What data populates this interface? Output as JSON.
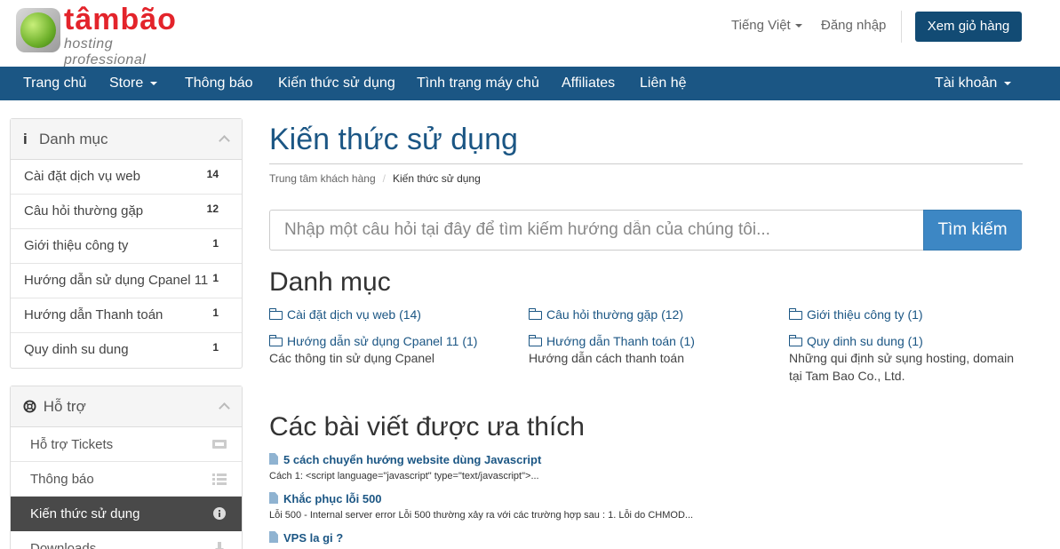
{
  "header": {
    "brand": "tâmbão",
    "tagline": "hosting professional",
    "language": "Tiếng Việt",
    "login": "Đăng nhập",
    "cart_button": "Xem giỏ hàng"
  },
  "nav": {
    "items": [
      "Trang chủ",
      "Store",
      "Thông báo",
      "Kiến thức sử dụng",
      "Tình trạng máy chủ",
      "Affiliates",
      "Liên hệ"
    ],
    "account": "Tài khoản"
  },
  "sidebar": {
    "categories_title": "Danh mục",
    "categories": [
      {
        "label": "Cài đặt dịch vụ web",
        "count": "14"
      },
      {
        "label": "Câu hỏi thường gặp",
        "count": "12"
      },
      {
        "label": "Giới thiệu công ty",
        "count": "1"
      },
      {
        "label": "Hướng dẫn sử dụng Cpanel 11",
        "count": "1"
      },
      {
        "label": "Hướng dẫn Thanh toán",
        "count": "1"
      },
      {
        "label": "Quy dinh su dung",
        "count": "1"
      }
    ],
    "support_title": "Hỗ trợ",
    "support": [
      {
        "label": "Hỗ trợ Tickets",
        "icon": "ticket-icon"
      },
      {
        "label": "Thông báo",
        "icon": "list-icon"
      },
      {
        "label": "Kiến thức sử dụng",
        "icon": "info-icon"
      },
      {
        "label": "Downloads",
        "icon": "download-icon"
      }
    ]
  },
  "main": {
    "title": "Kiến thức sử dụng",
    "breadcrumb": [
      "Trung tâm khách hàng",
      "Kiến thức sử dụng"
    ],
    "search_placeholder": "Nhập một câu hỏi tại đây để tìm kiếm hướng dẫn của chúng tôi...",
    "search_button": "Tìm kiếm",
    "categories_heading": "Danh mục",
    "kb_categories": [
      {
        "label": "Cài đặt dịch vụ web (14)",
        "desc": ""
      },
      {
        "label": "Câu hỏi thường gặp (12)",
        "desc": ""
      },
      {
        "label": "Giới thiệu công ty (1)",
        "desc": ""
      },
      {
        "label": "Hướng dẫn sử dụng Cpanel 11 (1)",
        "desc": "Các thông tin sử dụng Cpanel"
      },
      {
        "label": "Hướng dẫn Thanh toán (1)",
        "desc": "Hướng dẫn cách thanh toán"
      },
      {
        "label": "Quy dinh su dung (1)",
        "desc": "Những qui định sử sụng hosting, domain tại Tam Bao Co., Ltd."
      }
    ],
    "popular_heading": "Các bài viết được ưa thích",
    "articles": [
      {
        "title": "5 cách chuyển hướng website dùng Javascript",
        "snippet": "Cách 1: <script language=\"javascript\" type=\"text/javascript\">..."
      },
      {
        "title": "Khắc phục lỗi 500",
        "snippet": "Lỗi 500 - Internal server error Lỗi 500 thường xảy ra với các trường hợp sau : 1. Lỗi do CHMOD..."
      },
      {
        "title": "VPS la gi ?",
        "snippet": ""
      }
    ]
  },
  "colors": {
    "primary": "#1b5684",
    "nav_bg": "#1b5684",
    "button": "#124b74",
    "search_button": "#3d87c4",
    "brand_red": "#e3242b"
  }
}
